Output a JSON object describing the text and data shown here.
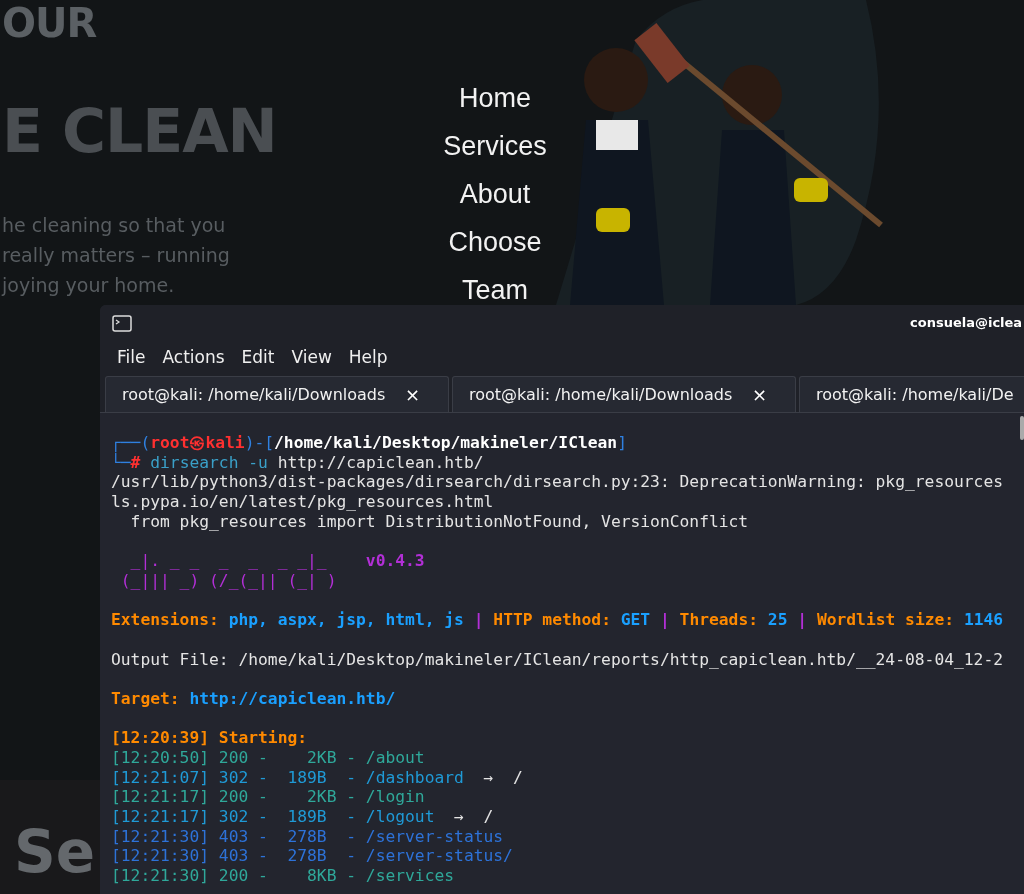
{
  "website": {
    "heading_top": "OUR",
    "heading_main": "E CLEAN",
    "paragraph": [
      "he cleaning so that you",
      "really matters – running",
      "joying your home."
    ],
    "nav": [
      {
        "label": "Home"
      },
      {
        "label": "Services"
      },
      {
        "label": "About"
      },
      {
        "label": "Choose"
      },
      {
        "label": "Team"
      }
    ],
    "section_heading": "Se"
  },
  "terminal": {
    "title": "consuela@iclea",
    "menu": [
      "File",
      "Actions",
      "Edit",
      "View",
      "Help"
    ],
    "tabs": [
      {
        "label": "root@kali: /home/kali/Downloads",
        "close": "×"
      },
      {
        "label": "root@kali: /home/kali/Downloads",
        "close": "×"
      },
      {
        "label": "root@kali: /home/kali/De"
      }
    ],
    "lines": [
      {
        "kind": "text",
        "segments": [
          {
            "kind": "frame",
            "text": "┌──("
          },
          {
            "kind": "user",
            "text": "root㉿kali"
          },
          {
            "kind": "frame",
            "text": ")-["
          },
          {
            "kind": "path",
            "text": "/home/kali/Desktop/makineler/IClean"
          },
          {
            "kind": "frame",
            "text": "]"
          }
        ]
      },
      {
        "kind": "text",
        "segments": [
          {
            "kind": "frame",
            "text": "└─"
          },
          {
            "kind": "hash",
            "text": "# "
          },
          {
            "kind": "cmd",
            "text": "dirsearch -u"
          },
          {
            "kind": "plain",
            "text": " http://capiclean.htb/"
          }
        ]
      },
      {
        "kind": "text",
        "segments": [
          {
            "kind": "plain",
            "text": "/usr/lib/python3/dist-packages/dirsearch/dirsearch.py:23: DeprecationWarning: pkg_resources"
          }
        ]
      },
      {
        "kind": "text",
        "segments": [
          {
            "kind": "plain",
            "text": "ls.pypa.io/en/latest/pkg_resources.html"
          }
        ]
      },
      {
        "kind": "text",
        "segments": [
          {
            "kind": "plain",
            "text": "  from pkg_resources import DistributionNotFound, VersionConflict"
          }
        ]
      },
      {
        "kind": "blank"
      },
      {
        "kind": "text",
        "segments": [
          {
            "kind": "banner",
            "text": "  _|. _ _  _  _  _ _|_    "
          },
          {
            "kind": "version",
            "text": "v0.4.3"
          }
        ]
      },
      {
        "kind": "text",
        "segments": [
          {
            "kind": "banner",
            "text": " (_||| _) (/_(_|| (_| )"
          }
        ]
      },
      {
        "kind": "blank"
      },
      {
        "kind": "text",
        "segments": [
          {
            "kind": "key",
            "text": "Extensions: "
          },
          {
            "kind": "value",
            "text": "php, aspx, jsp, html, js"
          },
          {
            "kind": "sep",
            "text": " | "
          },
          {
            "kind": "key",
            "text": "HTTP method: "
          },
          {
            "kind": "value",
            "text": "GET"
          },
          {
            "kind": "sep",
            "text": " | "
          },
          {
            "kind": "key",
            "text": "Threads: "
          },
          {
            "kind": "value",
            "text": "25"
          },
          {
            "kind": "sep",
            "text": " | "
          },
          {
            "kind": "key",
            "text": "Wordlist size: "
          },
          {
            "kind": "value",
            "text": "1146"
          }
        ]
      },
      {
        "kind": "blank"
      },
      {
        "kind": "text",
        "segments": [
          {
            "kind": "plain",
            "text": "Output File: /home/kali/Desktop/makineler/IClean/reports/http_capiclean.htb/__24-08-04_12-2"
          }
        ]
      },
      {
        "kind": "blank"
      },
      {
        "kind": "text",
        "segments": [
          {
            "kind": "key",
            "text": "Target: "
          },
          {
            "kind": "value",
            "text": "http://capiclean.htb/"
          }
        ]
      },
      {
        "kind": "blank"
      },
      {
        "kind": "text",
        "segments": [
          {
            "kind": "key",
            "text": "[12:20:39] Starting:"
          }
        ]
      },
      {
        "kind": "text",
        "segments": [
          {
            "kind": "ok",
            "text": "[12:20:50] 200 -    2KB - /about"
          }
        ]
      },
      {
        "kind": "text",
        "segments": [
          {
            "kind": "redirect",
            "text": "[12:21:07] 302 -  189B  - /dashboard"
          },
          {
            "kind": "plain",
            "text": "  →  /"
          }
        ]
      },
      {
        "kind": "text",
        "segments": [
          {
            "kind": "ok",
            "text": "[12:21:17] 200 -    2KB - /login"
          }
        ]
      },
      {
        "kind": "text",
        "segments": [
          {
            "kind": "redirect",
            "text": "[12:21:17] 302 -  189B  - /logout"
          },
          {
            "kind": "plain",
            "text": "  →  /"
          }
        ]
      },
      {
        "kind": "text",
        "segments": [
          {
            "kind": "forbidden",
            "text": "[12:21:30] 403 -  278B  - /server-status"
          }
        ]
      },
      {
        "kind": "text",
        "segments": [
          {
            "kind": "forbidden",
            "text": "[12:21:30] 403 -  278B  - /server-status/"
          }
        ]
      },
      {
        "kind": "text",
        "segments": [
          {
            "kind": "ok",
            "text": "[12:21:30] 200 -    8KB - /services"
          }
        ]
      }
    ]
  }
}
